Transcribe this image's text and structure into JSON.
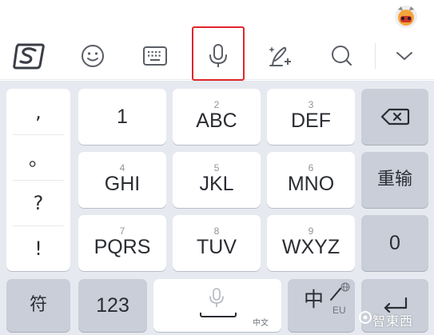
{
  "toolbar": {
    "icons": [
      "sogou-logo-icon",
      "emoji-icon",
      "keyboard-icon",
      "microphone-icon",
      "handwriting-icon",
      "search-icon",
      "chevron-down-icon"
    ]
  },
  "punctuation": [
    ",",
    "。",
    "?",
    "!"
  ],
  "keys": {
    "k1": {
      "label": "1"
    },
    "k2": {
      "num": "2",
      "label": "ABC"
    },
    "k3": {
      "num": "3",
      "label": "DEF"
    },
    "k4": {
      "num": "4",
      "label": "GHI"
    },
    "k5": {
      "num": "5",
      "label": "JKL"
    },
    "k6": {
      "num": "6",
      "label": "MNO"
    },
    "k7": {
      "num": "7",
      "label": "PQRS"
    },
    "k8": {
      "num": "8",
      "label": "TUV"
    },
    "k9": {
      "num": "9",
      "label": "WXYZ"
    },
    "k0": {
      "label": "0"
    },
    "reenter": {
      "label": "重输"
    },
    "symbol": {
      "label": "符"
    },
    "numeric": {
      "label": "123"
    },
    "space": {
      "sub": "中文"
    },
    "lang": {
      "zh": "中",
      "eu": "EU"
    }
  },
  "watermark": {
    "text": "智東西"
  },
  "colors": {
    "highlight": "#e0262b",
    "keyboard_bg": "#e6e9ef",
    "key_dark": "#c9ced8"
  }
}
